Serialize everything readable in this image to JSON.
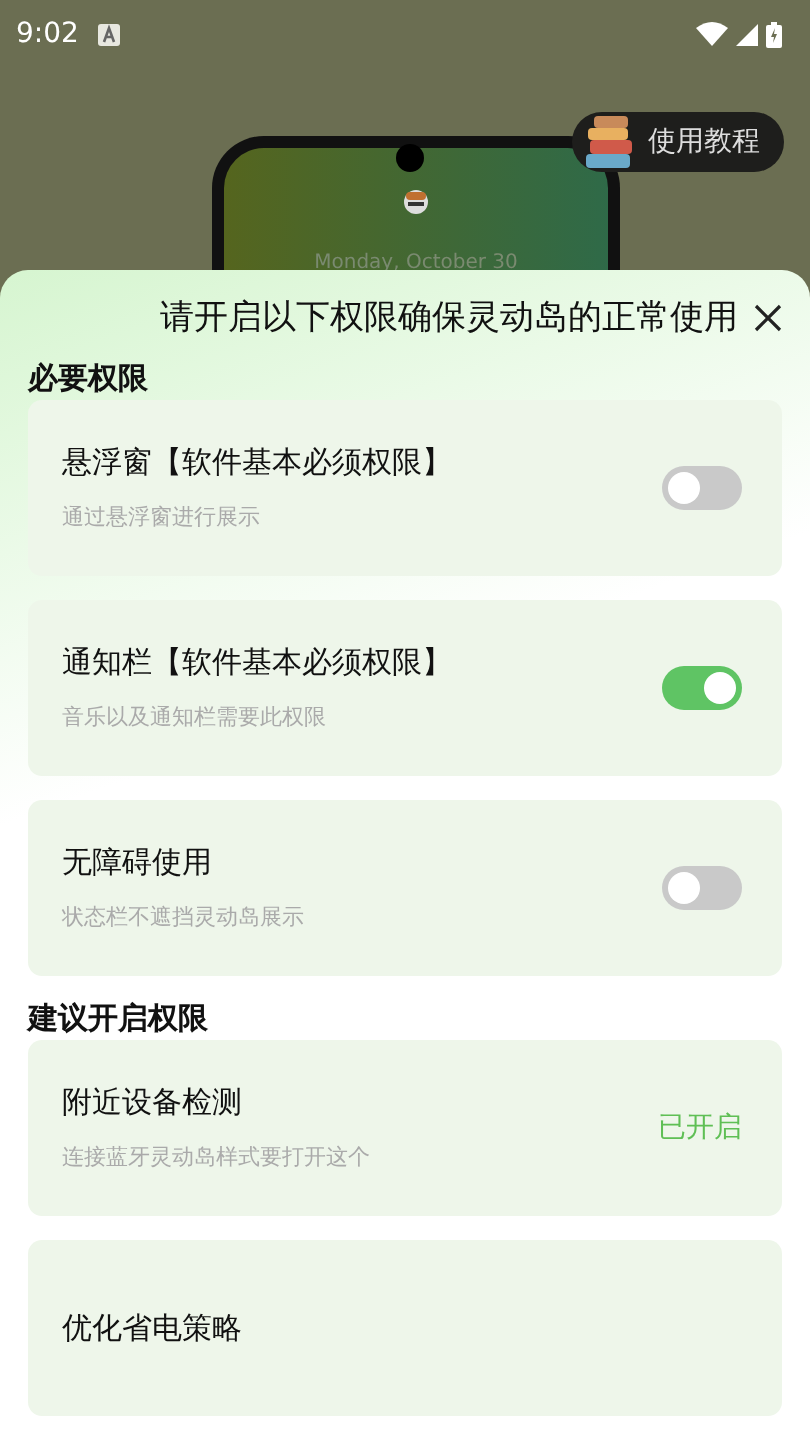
{
  "status_bar": {
    "time": "9:02"
  },
  "background": {
    "tutorial_button": "使用教程",
    "preview_date": "Monday, October 30"
  },
  "sheet": {
    "title": "请开启以下权限确保灵动岛的正常使用",
    "sections": [
      {
        "heading": "必要权限",
        "items": [
          {
            "kind": "toggle",
            "title": "悬浮窗【软件基本必须权限】",
            "subtitle": "通过悬浮窗进行展示",
            "on": false
          },
          {
            "kind": "toggle",
            "title": "通知栏【软件基本必须权限】",
            "subtitle": "音乐以及通知栏需要此权限",
            "on": true
          },
          {
            "kind": "toggle",
            "title": "无障碍使用",
            "subtitle": "状态栏不遮挡灵动岛展示",
            "on": false
          }
        ]
      },
      {
        "heading": "建议开启权限",
        "items": [
          {
            "kind": "status",
            "title": "附近设备检测",
            "subtitle": "连接蓝牙灵动岛样式要打开这个",
            "status": "已开启"
          },
          {
            "kind": "status",
            "title": "优化省电策略"
          }
        ]
      }
    ]
  }
}
